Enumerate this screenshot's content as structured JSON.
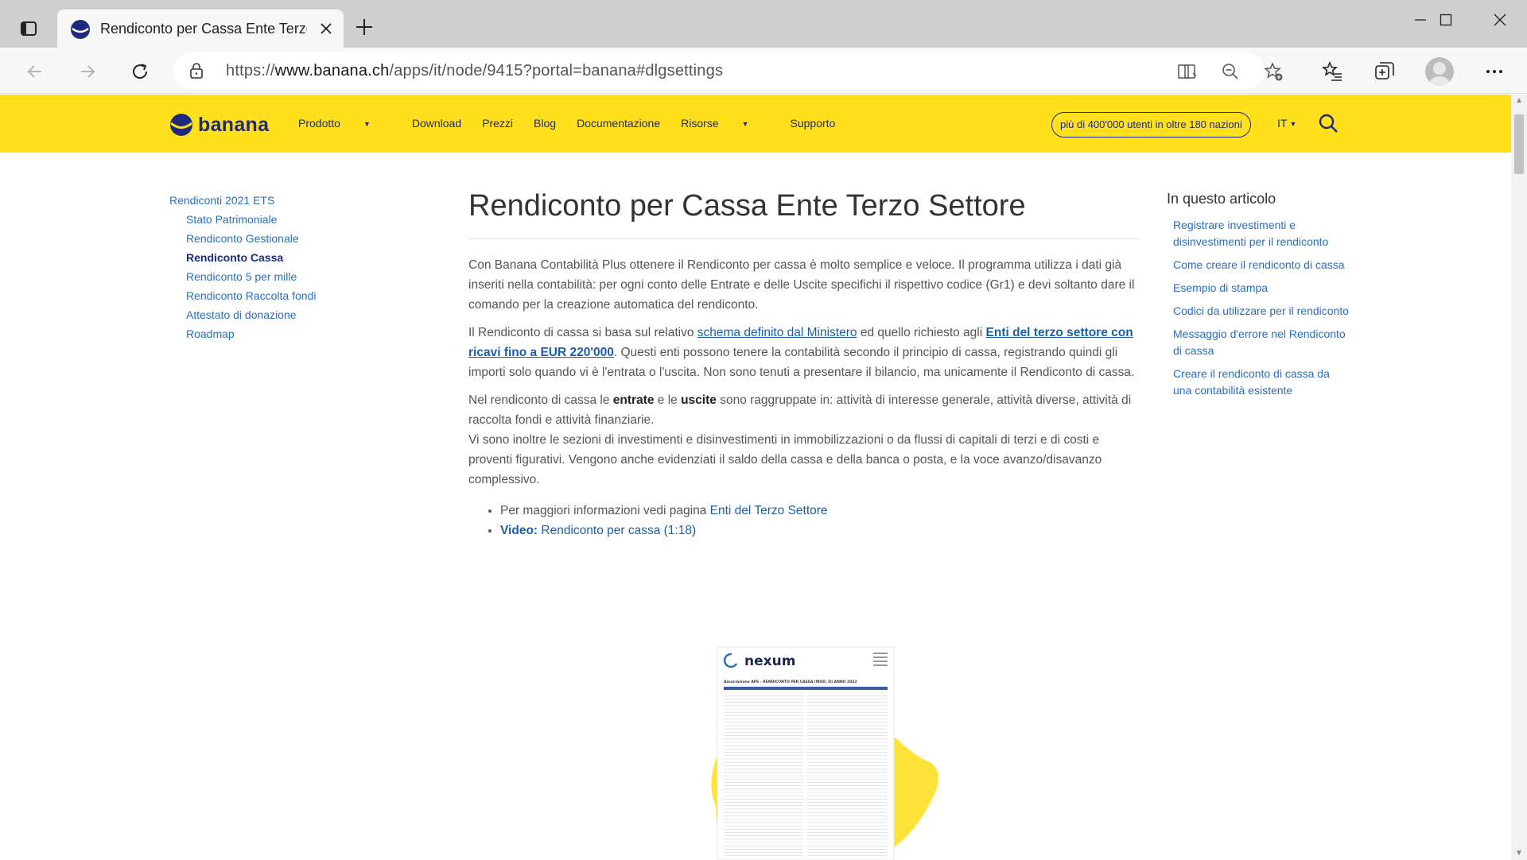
{
  "browser": {
    "tab_title": "Rendiconto per Cassa Ente Terzo",
    "url_prefix": "https://",
    "url_host": "www.banana.ch",
    "url_path": "/apps/it/node/9415?portal=banana#dlgsettings"
  },
  "site": {
    "logo_text": "banana",
    "nav": [
      {
        "label": "Prodotto",
        "dropdown": true
      },
      {
        "label": "Download",
        "dropdown": false
      },
      {
        "label": "Prezzi",
        "dropdown": false
      },
      {
        "label": "Blog",
        "dropdown": false
      },
      {
        "label": "Documentazione",
        "dropdown": false
      },
      {
        "label": "Risorse",
        "dropdown": true
      },
      {
        "label": "Supporto",
        "dropdown": false
      }
    ],
    "users_pill": "più di 400'000 utenti in oltre 180 nazioni",
    "lang": "IT",
    "colors": {
      "header_bg": "#ffe01b",
      "brand_blue": "#1e2b7a",
      "link": "#2a6ebb"
    }
  },
  "left_nav": {
    "root": "Rendiconti 2021 ETS",
    "items": [
      {
        "label": "Stato Patrimoniale",
        "active": false
      },
      {
        "label": "Rendiconto Gestionale",
        "active": false
      },
      {
        "label": "Rendiconto Cassa",
        "active": true
      },
      {
        "label": "Rendiconto 5 per mille",
        "active": false
      },
      {
        "label": "Rendiconto Raccolta fondi",
        "active": false
      },
      {
        "label": "Attestato di donazione",
        "active": false
      },
      {
        "label": "Roadmap",
        "active": false
      }
    ]
  },
  "article": {
    "title": "Rendiconto per Cassa Ente Terzo Settore",
    "p1": "Con Banana Contabilità Plus ottenere il Rendiconto per cassa è molto semplice e veloce. Il programma utilizza i dati già inseriti nella contabilità: per ogni conto delle Entrate e delle Uscite specifichi il rispettivo codice (Gr1) e devi soltanto dare il comando per la creazione automatica del rendiconto.",
    "p2_a": "Il Rendiconto di cassa si basa sul relativo ",
    "p2_link1": "schema definito dal Ministero",
    "p2_b": " ed quello richiesto agli ",
    "p2_link2": "Enti del terzo settore con ricavi fino a EUR 220'000",
    "p2_c": ". Questi enti possono tenere la contabilità secondo il principio di cassa, registrando quindi gli importi solo quando vi è l'entrata o l'uscita. Non sono tenuti a presentare il bilancio, ma unicamente il Rendiconto di cassa.",
    "p3_a": "Nel rendiconto di cassa le ",
    "p3_b1": "entrate",
    "p3_b": " e le ",
    "p3_b2": "uscite",
    "p3_c": " sono raggruppate in: attività di interesse generale, attività diverse, attività di raccolta fondi e attività finanziarie.",
    "p3_d": "Vi sono inoltre le sezioni di investimenti e disinvestimenti in immobilizzazioni o da flussi di capitali di terzi e di costi e proventi figurativi. Vengono anche evidenziati il saldo della cassa e della banca o posta, e la voce avanzo/disavanzo complessivo.",
    "li1_text": "Per maggiori informazioni vedi pagina ",
    "li1_link": "Enti del Terzo Settore",
    "li2_bold": "Video:",
    "li2_link": " Rendiconto per cassa (1:18)"
  },
  "toc": {
    "title": "In questo articolo",
    "items": [
      "Registrare investimenti e disinvestimenti per il rendiconto",
      "Come creare il rendiconto di cassa",
      "Esempio di stampa",
      "Codici da utilizzare per il rendiconto",
      "Messaggio d'errore nel Rendiconto di cassa",
      "Creare il rendiconto di cassa da una contabilità esistente"
    ]
  },
  "illustration": {
    "brand": "nexum",
    "doc_title": "Associazione APS - RENDICONTO PER CASSA (MOD. D) ANNO 2022"
  }
}
